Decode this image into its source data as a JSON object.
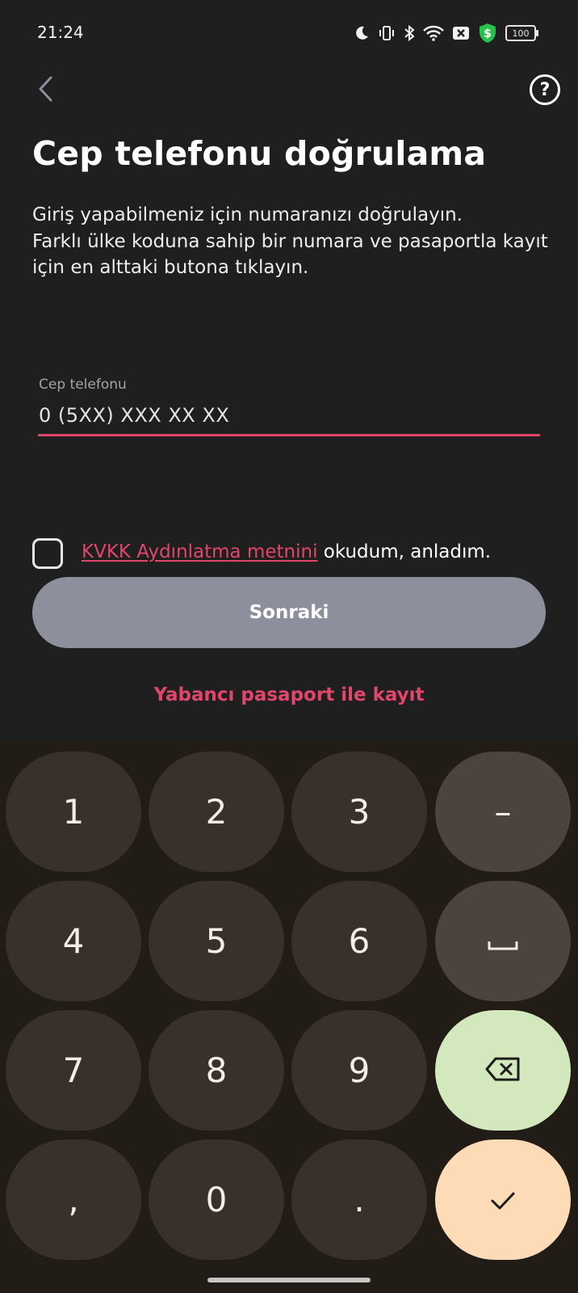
{
  "status_bar": {
    "time": "21:24",
    "battery": "100",
    "icons": [
      "moon-icon",
      "vibrate-icon",
      "bluetooth-icon",
      "wifi-icon",
      "close-box-icon",
      "shield-dollar-icon",
      "battery-icon"
    ]
  },
  "header": {
    "back_icon": "chevron-left-icon",
    "help_icon": "question-circle-icon",
    "help_glyph": "?"
  },
  "title": "Cep telefonu doğrulama",
  "description": "Giriş yapabilmeniz için numaranızı doğrulayın.\n Farklı ülke koduna sahip bir numara ve pasaportla kayıt için en alttaki butona tıklayın.",
  "phone_field": {
    "label": "Cep telefonu",
    "value": "0 (5XX) XXX XX XX"
  },
  "consent": {
    "checked": false,
    "link_text": "KVKK Aydınlatma metnini",
    "rest_text": " okudum, anladım."
  },
  "next_button": "Sonraki",
  "foreign_passport_link": "Yabancı pasaport ile kayıt",
  "keyboard": {
    "keys": [
      "1",
      "2",
      "3",
      "–",
      "4",
      "5",
      "6",
      "␣",
      "7",
      "8",
      "9",
      "⌫",
      ",",
      "0",
      ".",
      "✓"
    ]
  },
  "colors": {
    "accent": "#e0466a",
    "background": "#1f1f1f",
    "button_disabled": "#8e8f9c",
    "keyboard_bg": "#221c17",
    "backspace_key": "#d3e8bd",
    "confirm_key": "#fddbb6"
  }
}
